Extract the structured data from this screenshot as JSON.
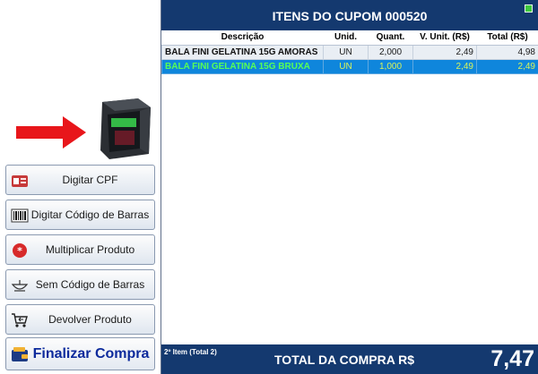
{
  "sidebar": {
    "buttons": [
      {
        "label": "Digitar CPF",
        "icon": "id-card-icon"
      },
      {
        "label": "Digitar Código de Barras",
        "icon": "barcode-icon"
      },
      {
        "label": "Multiplicar Produto",
        "icon": "multiply-icon"
      },
      {
        "label": "Sem Código de Barras",
        "icon": "scale-icon"
      },
      {
        "label": "Devolver Produto",
        "icon": "cart-return-icon"
      }
    ],
    "finalize_label": "Finalizar Compra",
    "finalize_icon": "wallet-icon"
  },
  "receipt": {
    "title": "ITENS DO CUPOM 000520",
    "columns": [
      "Descrição",
      "Unid.",
      "Quant.",
      "V. Unit. (R$)",
      "Total (R$)"
    ],
    "items": [
      {
        "desc": "BALA FINI GELATINA 15G AMORAS",
        "unit": "UN",
        "qty": "2,000",
        "unit_price": "2,49",
        "total": "4,98",
        "selected": false
      },
      {
        "desc": "BALA FINI GELATINA 15G BRUXA",
        "unit": "UN",
        "qty": "1,000",
        "unit_price": "2,49",
        "total": "2,49",
        "selected": true
      }
    ],
    "item_count": "2º Item (Total 2)",
    "total_label": "TOTAL DA COMPRA R$",
    "total_value": "7,47"
  },
  "colors": {
    "header_bg": "#14396f",
    "selected_row_bg": "#0f86dc",
    "selected_text": "#57ff57",
    "finalize_text": "#0c2a9c",
    "arrow": "#e8161b",
    "status": "#3ec93e"
  }
}
